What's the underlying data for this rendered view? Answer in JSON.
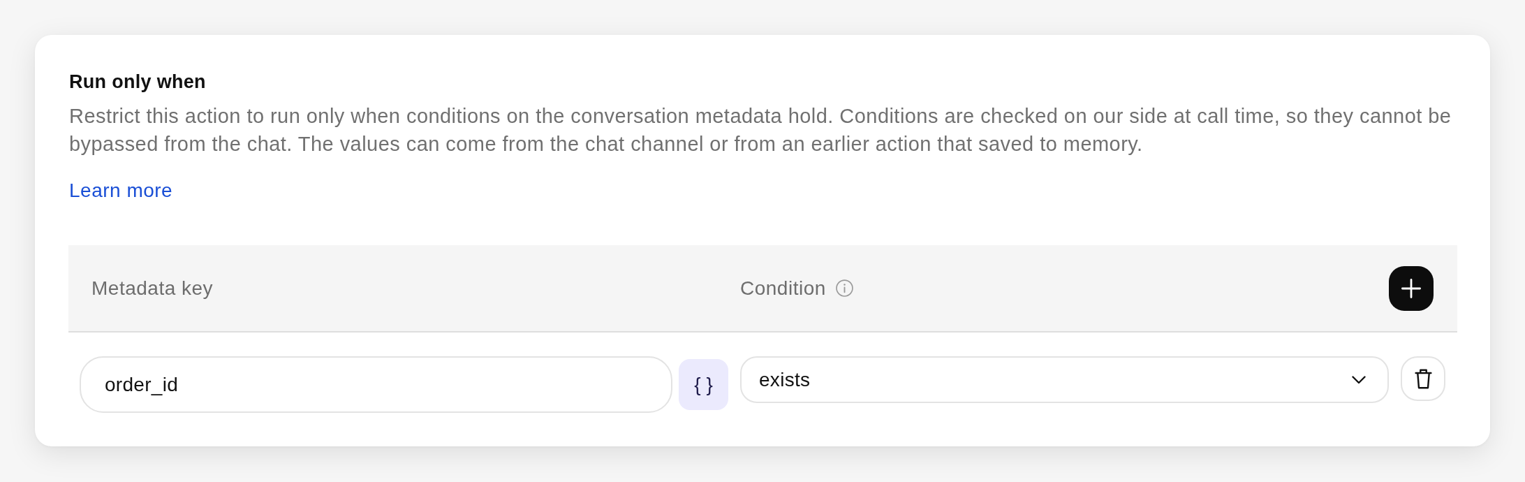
{
  "section": {
    "title": "Run only when",
    "description": "Restrict this action to run only when conditions on the conversation metadata hold. Conditions are checked on our side at call time, so they cannot be bypassed from the chat. The values can come from the chat channel or from an earlier action that saved to memory.",
    "link": "Learn more"
  },
  "table": {
    "columns": [
      {
        "label": "Metadata key",
        "info": false
      },
      {
        "label": "Condition",
        "info": true
      }
    ],
    "rows": [
      {
        "key": "order_id",
        "variable_button": "{ }",
        "condition": "exists"
      }
    ]
  }
}
